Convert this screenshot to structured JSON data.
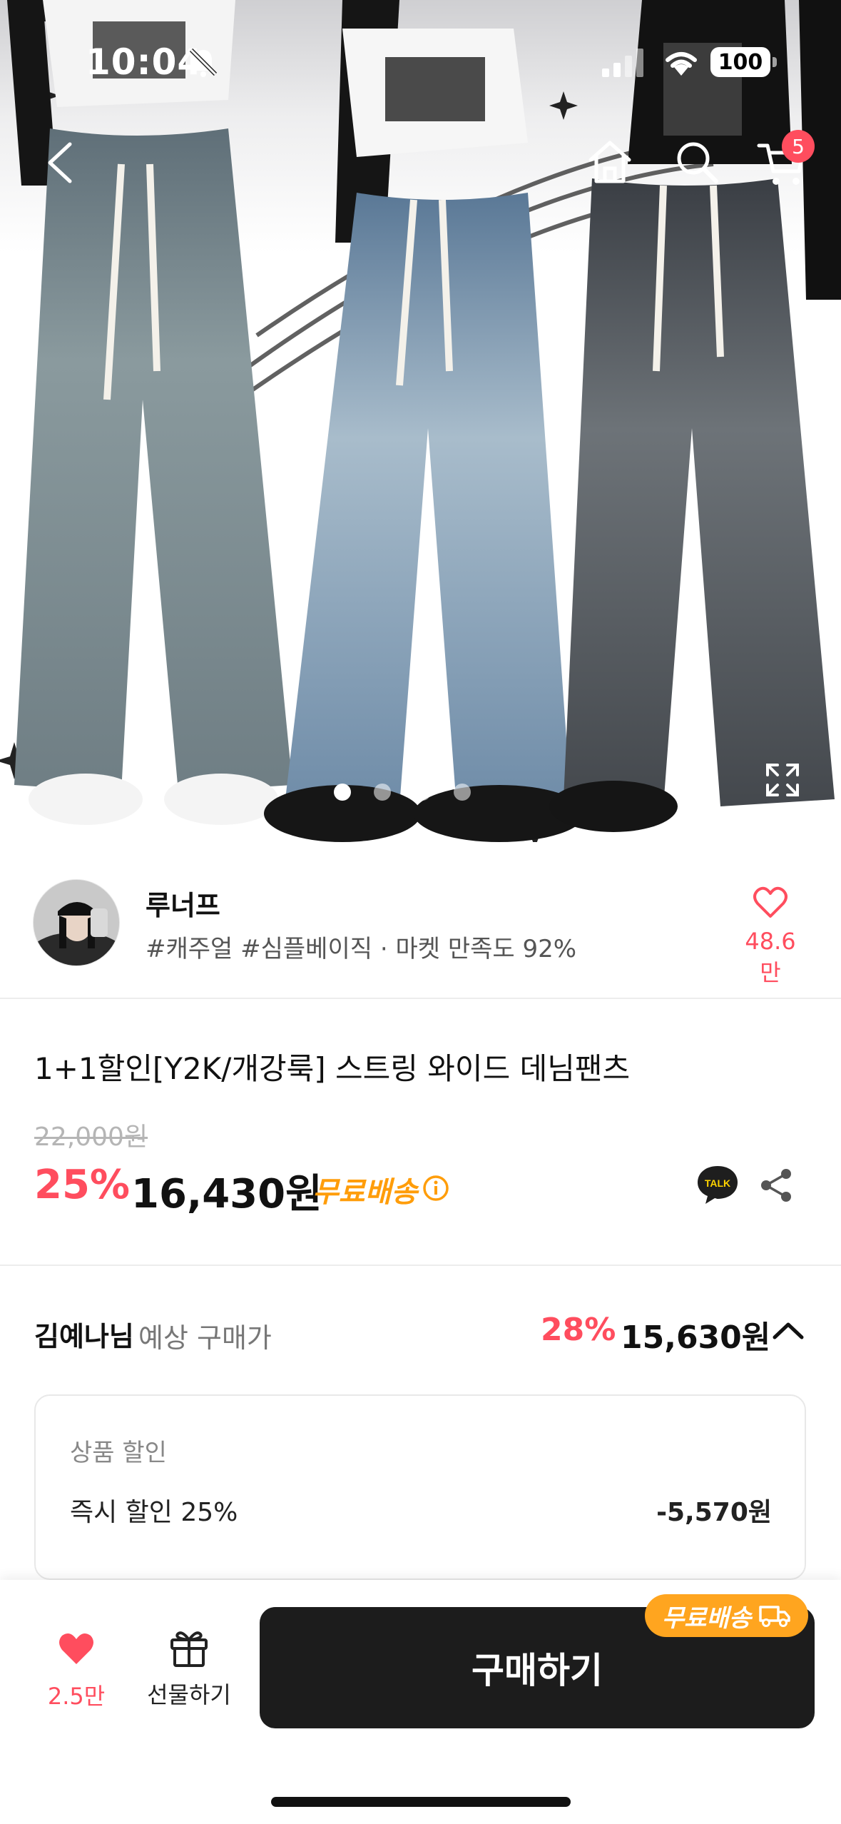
{
  "status_bar": {
    "time": "10:04",
    "battery": "100"
  },
  "header": {
    "cart_count": "5"
  },
  "gallery": {
    "pages": 4,
    "active_index": 0
  },
  "seller": {
    "name": "루너프",
    "tags": "#캐주얼 #심플베이직 · 마켓 만족도 92%",
    "favorite_count": "48.6만"
  },
  "product": {
    "title": "1+1할인[Y2K/개강룩] 스트링 와이드 데님팬츠",
    "original_price": "22,000원",
    "discount_rate": "25%",
    "price": "16,430원",
    "free_shipping": "무료배송",
    "talk_label": "TALK"
  },
  "expected": {
    "user_name": "김예나님",
    "label": "예상 구매가",
    "discount_rate": "28%",
    "price": "15,630원",
    "detail_heading": "상품 할인",
    "rows": [
      {
        "label": "즉시 할인 25%",
        "value": "-5,570원"
      }
    ]
  },
  "bottom_bar": {
    "like_count": "2.5만",
    "gift_label": "선물하기",
    "buy_label": "구매하기",
    "ship_badge": "무료배송"
  },
  "colors": {
    "accent": "#ff4d5e",
    "orange": "#ff9d0a",
    "dark": "#1c1c1c"
  }
}
